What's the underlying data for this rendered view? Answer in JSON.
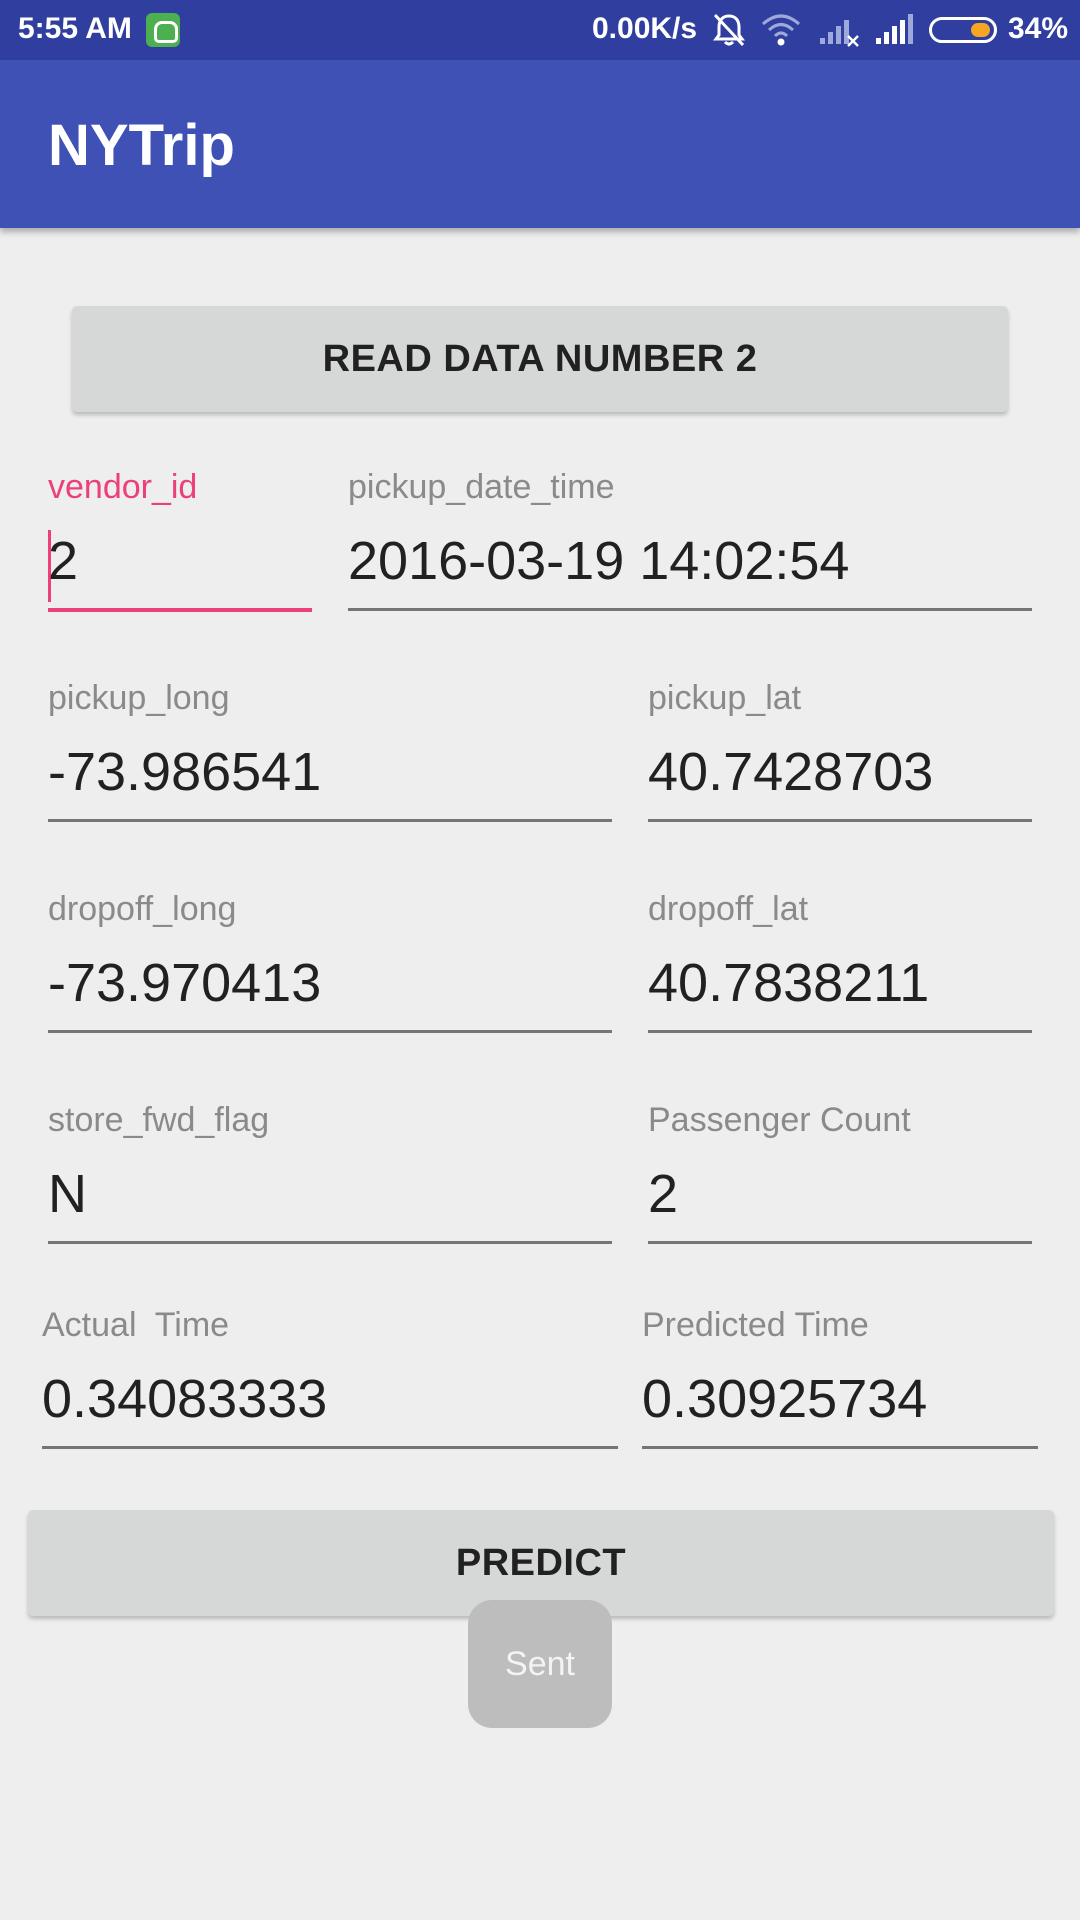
{
  "status_bar": {
    "time": "5:55 AM",
    "network_speed": "0.00K/s",
    "battery_percent": "34%",
    "icons": [
      "app-notification-icon",
      "bell-muted-icon",
      "wifi-icon",
      "signal-no-sim-icon",
      "signal-icon",
      "battery-icon"
    ],
    "battery_level": 0.34,
    "color": "#303f9f"
  },
  "app_bar": {
    "title": "NYTrip",
    "color": "#3f51b5"
  },
  "read_button": {
    "label": "READ DATA NUMBER 2"
  },
  "fields": {
    "vendor_id": {
      "label": "vendor_id",
      "value": "2"
    },
    "pickup_date_time": {
      "label": "pickup_date_time",
      "value": "2016-03-19 14:02:54"
    },
    "pickup_long": {
      "label": "pickup_long",
      "value": "-73.986541"
    },
    "pickup_lat": {
      "label": "pickup_lat",
      "value": "40.7428703"
    },
    "dropoff_long": {
      "label": "dropoff_long",
      "value": "-73.970413"
    },
    "dropoff_lat": {
      "label": "dropoff_lat",
      "value": "40.7838211"
    },
    "store_fwd_flag": {
      "label": "store_fwd_flag",
      "value": "N"
    },
    "passenger_count": {
      "label": "Passenger Count",
      "value": "2"
    },
    "actual_time": {
      "label": "Actual  Time",
      "value": "0.34083333"
    },
    "predicted_time": {
      "label": "Predicted Time",
      "value": "0.30925734"
    }
  },
  "predict_button": {
    "label": "PREDICT"
  },
  "toast": {
    "text": "Sent"
  },
  "colors": {
    "accent": "#ec407a",
    "background": "#eeeeee",
    "button": "#d6d7d7"
  }
}
